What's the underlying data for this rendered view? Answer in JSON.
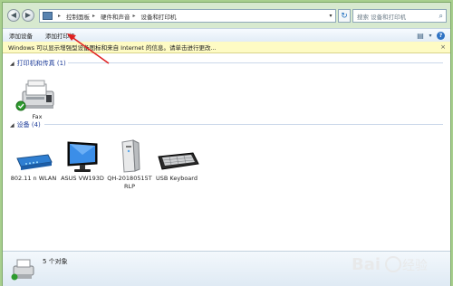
{
  "address": {
    "breadcrumbs": [
      "控制面板",
      "硬件和声音",
      "设备和打印机"
    ],
    "search_placeholder": "搜索 设备和打印机"
  },
  "toolbar": {
    "add_device": "添加设备",
    "add_printer": "添加打印机"
  },
  "info_bar": {
    "text": "Windows 可以显示增强型设备图标和来自 Internet 的信息。请单击进行更改..."
  },
  "groups": {
    "printers": {
      "title": "打印机和传真 (1)",
      "items": [
        {
          "label": "Fax",
          "icon": "fax-icon"
        }
      ]
    },
    "devices": {
      "title": "设备 (4)",
      "items": [
        {
          "label": "802.11 n WLAN",
          "icon": "wlan-adapter-icon"
        },
        {
          "label": "ASUS VW193D",
          "icon": "monitor-icon"
        },
        {
          "label": "QH-20180515T\nRLP",
          "icon": "computer-tower-icon"
        },
        {
          "label": "USB Keyboard",
          "icon": "keyboard-icon"
        }
      ]
    }
  },
  "details": {
    "count": "5 个对象"
  },
  "colors": {
    "window_bg": "#d7e9cf",
    "group_title": "#1e3d9a",
    "info_bar": "#fefbc4",
    "arrow": "#e02020"
  },
  "watermark": "Baidu 经验"
}
